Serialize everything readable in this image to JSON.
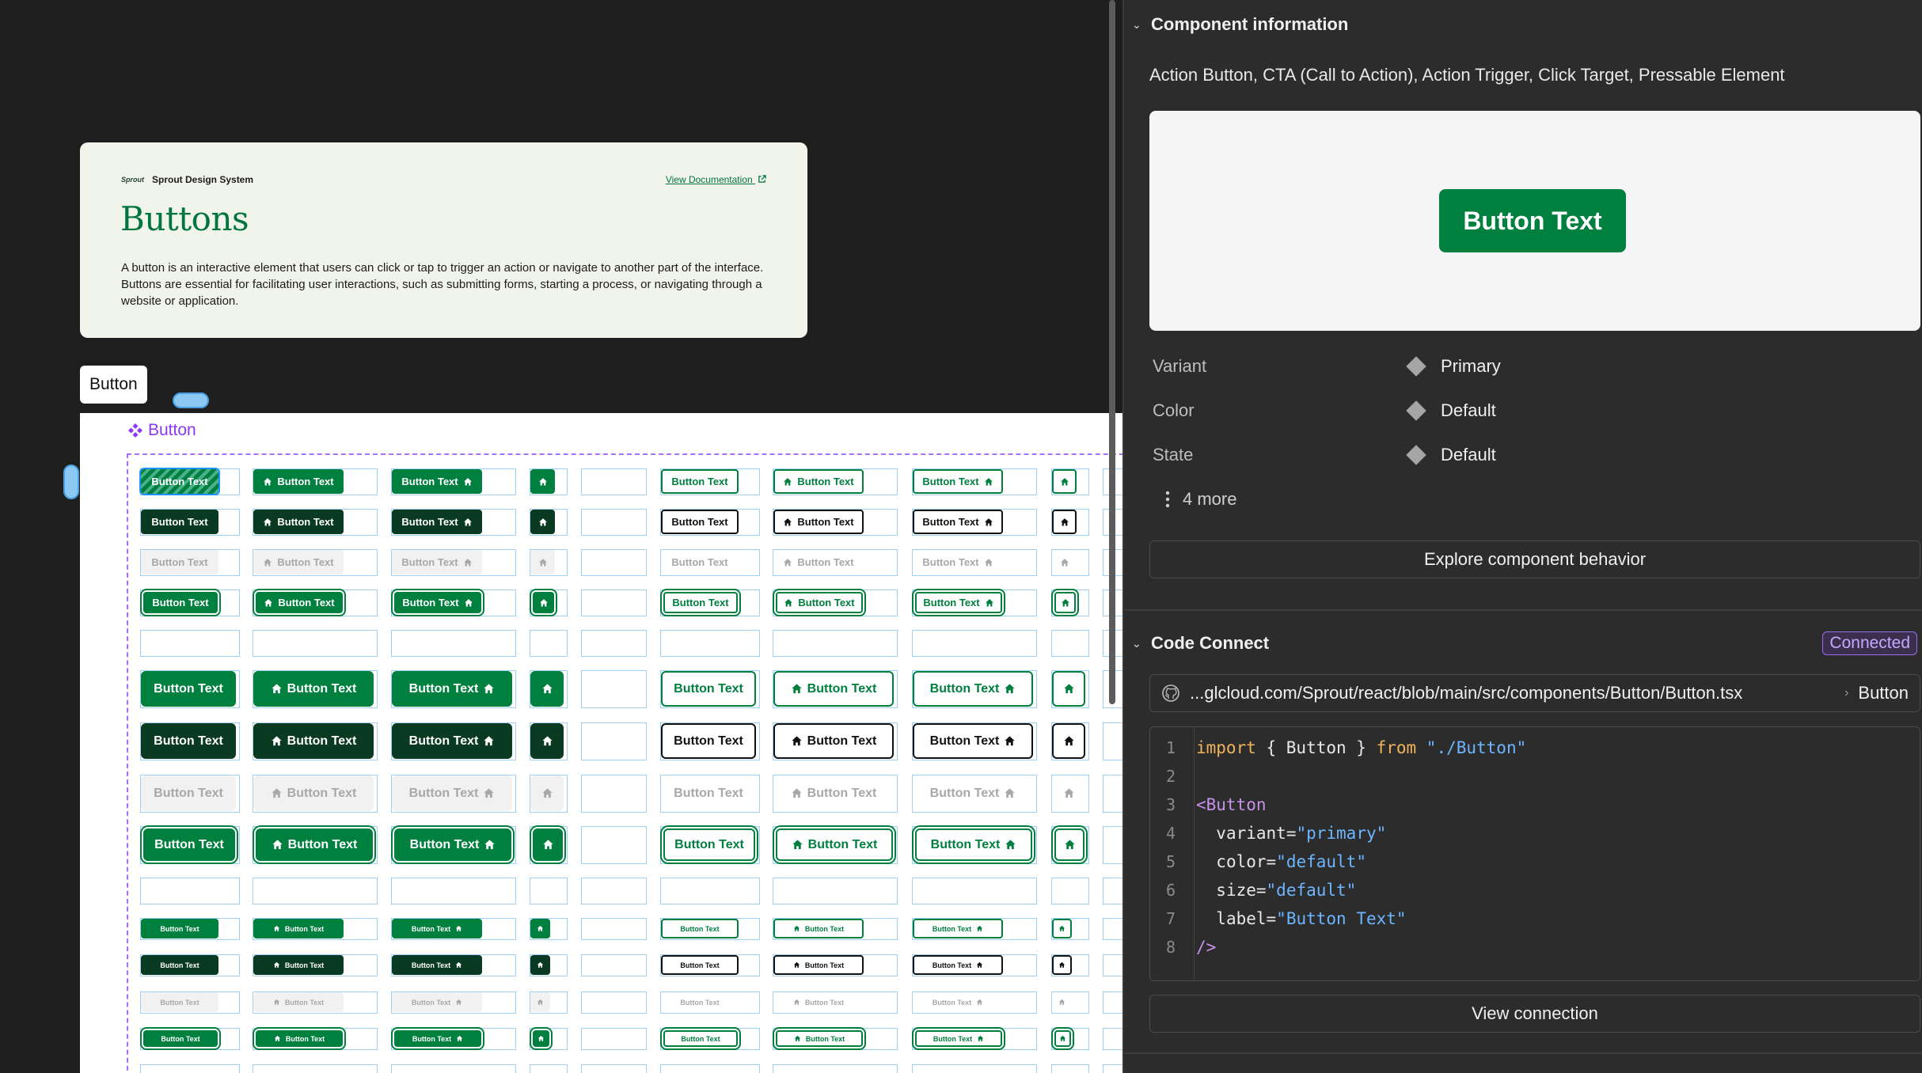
{
  "canvas": {
    "doc_card": {
      "logo_text": "Sprout",
      "brand_name": "Sprout Design System",
      "doc_link": "View Documentation",
      "title": "Buttons",
      "description": "A button is an interactive element that users can click or tap to trigger an action or navigate to another part of the interface. Buttons are essential for facilitating user interactions, such as submitting forms, starting a process, or navigating through a website or application."
    },
    "frame_label": "Button",
    "component_label": "Button",
    "button_text": "Button Text"
  },
  "panel": {
    "component_info": {
      "heading": "Component information",
      "aliases": "Action Button, CTA (Call to Action), Action Trigger, Click Target, Pressable Element",
      "preview_button": "Button Text",
      "properties": [
        {
          "name": "Variant",
          "value": "Primary"
        },
        {
          "name": "Color",
          "value": "Default"
        },
        {
          "name": "State",
          "value": "Default"
        }
      ],
      "more": "4 more",
      "explore_button": "Explore component behavior"
    },
    "code_connect": {
      "heading": "Code Connect",
      "status": "Connected",
      "path": "...glcloud.com/Sprout/react/blob/main/src/components/Button/Button.tsx",
      "component": "Button",
      "line_numbers": [
        "1",
        "2",
        "3",
        "4",
        "5",
        "6",
        "7",
        "8"
      ],
      "code": {
        "import_kw": "import",
        "import_names": " { Button } ",
        "from_kw": "from",
        "import_path": " \"./Button\"",
        "open_tag": "<Button",
        "attr_variant": "variant",
        "val_variant": "\"primary\"",
        "attr_color": "color",
        "val_color": "\"default\"",
        "attr_size": "size",
        "val_size": "\"default\"",
        "attr_label": "label",
        "val_label": "\"Button Text\"",
        "close_tag": "/>"
      },
      "view_button": "View connection"
    }
  },
  "colors": {
    "brand_green": "#00803f",
    "dark_green": "#0b3a22",
    "connected_purple": "#9c6cf0"
  }
}
